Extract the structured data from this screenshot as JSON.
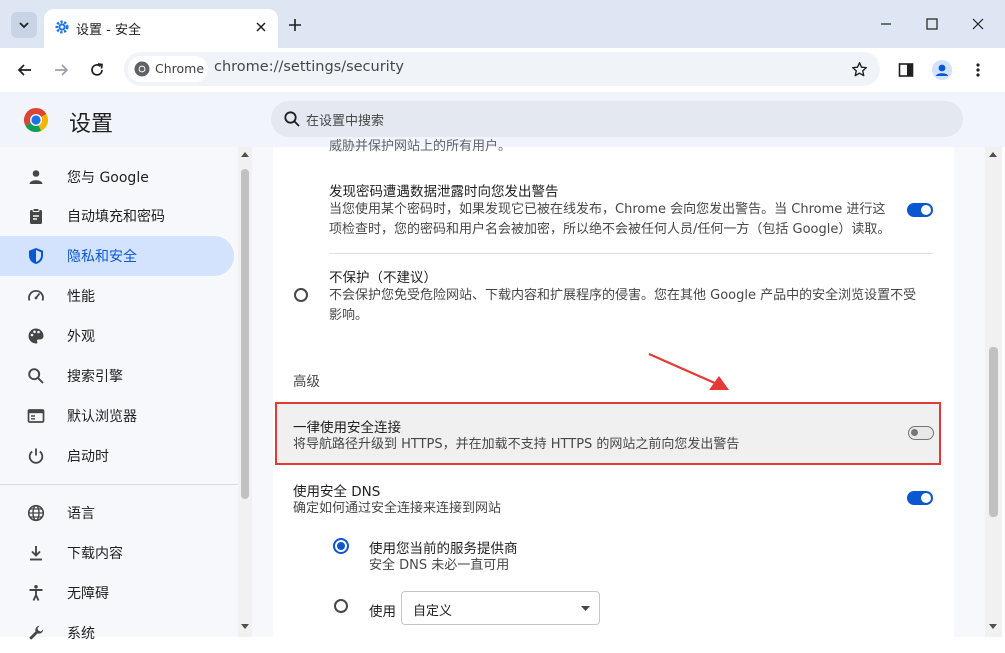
{
  "tab": {
    "title": "设置 - 安全",
    "icon": "gear-icon"
  },
  "toolbar": {
    "chip_label": "Chrome",
    "url": "chrome://settings/security"
  },
  "header": {
    "title": "设置",
    "search_placeholder": "在设置中搜索"
  },
  "sidebar": {
    "items": [
      {
        "label": "您与 Google",
        "icon": "person-icon"
      },
      {
        "label": "自动填充和密码",
        "icon": "clipboard-icon"
      },
      {
        "label": "隐私和安全",
        "icon": "shield-icon",
        "active": true
      },
      {
        "label": "性能",
        "icon": "speedometer-icon"
      },
      {
        "label": "外观",
        "icon": "palette-icon"
      },
      {
        "label": "搜索引擎",
        "icon": "search-icon"
      },
      {
        "label": "默认浏览器",
        "icon": "browser-window-icon"
      },
      {
        "label": "启动时",
        "icon": "power-icon"
      },
      {
        "label": "语言",
        "icon": "globe-icon"
      },
      {
        "label": "下载内容",
        "icon": "download-icon"
      },
      {
        "label": "无障碍",
        "icon": "accessibility-icon"
      },
      {
        "label": "系统",
        "icon": "wrench-icon"
      }
    ]
  },
  "main": {
    "cut_off_text": "威胁并保护网站上的所有用户。",
    "password_warning": {
      "title": "发现密码遭遇数据泄露时向您发出警告",
      "desc": "当您使用某个密码时，如果发现它已被在线发布，Chrome 会向您发出警告。当 Chrome 进行这项检查时，您的密码和用户名会被加密，所以绝不会被任何人员/任何一方（包括 Google）读取。",
      "enabled": true
    },
    "no_protection": {
      "title": "不保护（不建议）",
      "desc": "不会保护您免受危险网站、下载内容和扩展程序的侵害。您在其他 Google 产品中的安全浏览设置不受影响。",
      "selected": false
    },
    "advanced_heading": "高级",
    "https_only": {
      "title": "一律使用安全连接",
      "desc": "将导航路径升级到 HTTPS，并在加载不支持 HTTPS 的网站之前向您发出警告",
      "enabled": false
    },
    "secure_dns": {
      "title": "使用安全 DNS",
      "desc": "确定如何通过安全连接来连接到网站",
      "enabled": true,
      "option_current": {
        "title": "使用您当前的服务提供商",
        "desc": "安全 DNS 未必一直可用",
        "selected": true
      },
      "option_custom": {
        "label": "使用",
        "select_value": "自定义",
        "selected": false
      }
    }
  },
  "colors": {
    "accent": "#0b57d0",
    "highlight_border": "#e53935",
    "annotation_arrow": "#e53935"
  }
}
